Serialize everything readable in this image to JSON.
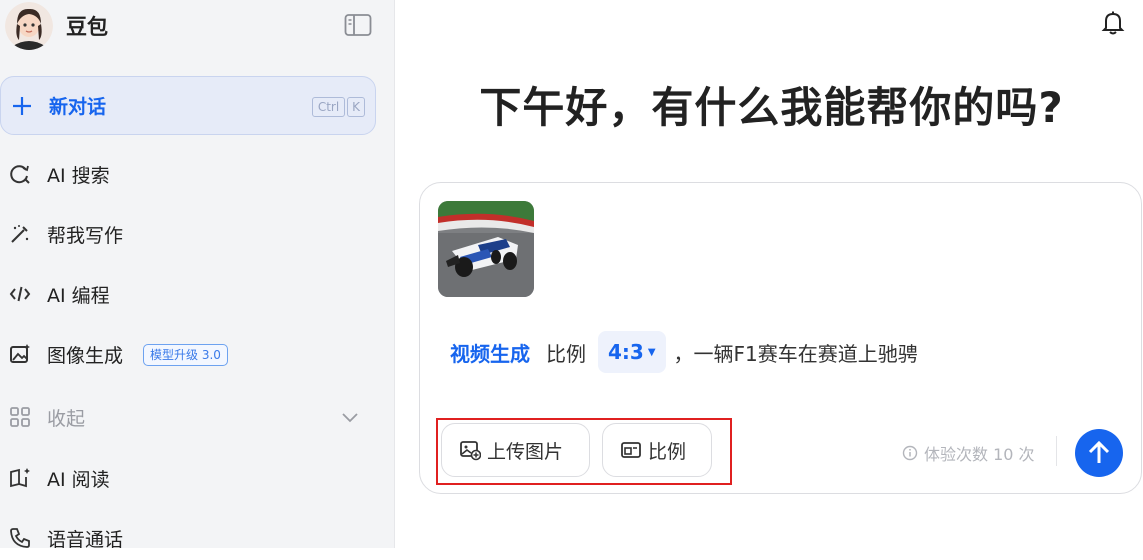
{
  "brand": {
    "name": "豆包"
  },
  "sidebar": {
    "new_chat": {
      "label": "新对话",
      "shortcut_ctrl": "Ctrl",
      "shortcut_key": "K"
    },
    "items": [
      {
        "label": "AI 搜索",
        "icon": "search-refresh-icon"
      },
      {
        "label": "帮我写作",
        "icon": "magic-pen-icon"
      },
      {
        "label": "AI 编程",
        "icon": "code-icon"
      },
      {
        "label": "图像生成",
        "icon": "image-spark-icon",
        "badge": "模型升级 3.0"
      },
      {
        "label": "收起",
        "icon": "grid-icon"
      },
      {
        "label": "AI 阅读",
        "icon": "book-icon"
      },
      {
        "label": "语音通话",
        "icon": "phone-icon"
      }
    ]
  },
  "main": {
    "greeting": "下午好，有什么我能帮你的吗?",
    "prompt": {
      "skill": "视频生成",
      "ratio_label": "比例",
      "ratio_value": "4:3",
      "text": "，一辆F1赛车在赛道上驰骋"
    },
    "toolbar": {
      "upload_label": "上传图片",
      "ratio_label": "比例",
      "quota_text": "体验次数 10 次"
    }
  },
  "colors": {
    "accent": "#1765ee",
    "highlight": "#e02020",
    "sidebar_bg": "#f3f4f6"
  }
}
